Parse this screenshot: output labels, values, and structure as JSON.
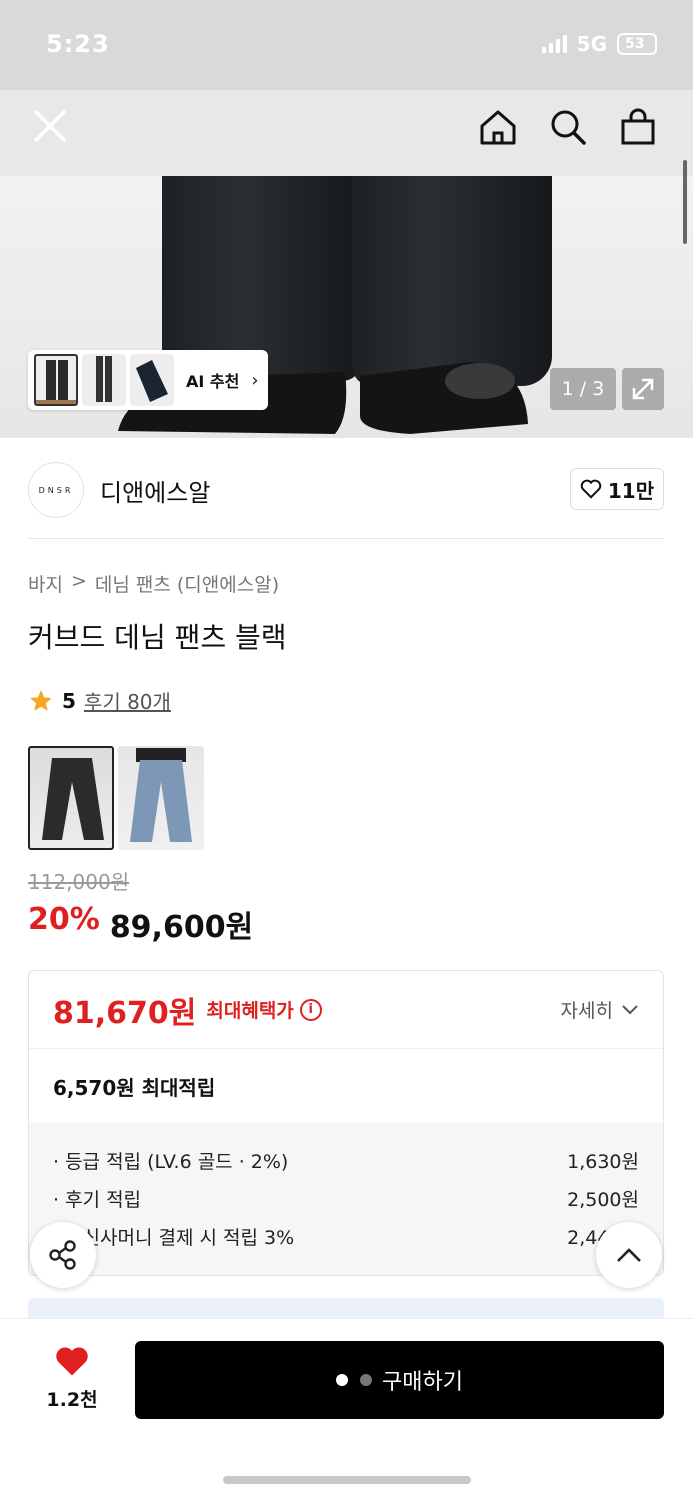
{
  "status_bar": {
    "time": "5:23",
    "network": "5G",
    "battery": "53"
  },
  "nav": {
    "close_icon": "close-icon",
    "home_icon": "home-icon",
    "search_icon": "search-icon",
    "cart_icon": "shopping-bag-icon"
  },
  "hero": {
    "ai_label": "AI 추천",
    "page_indicator": "1 / 3"
  },
  "brand": {
    "logo_text": "DNSR",
    "name": "디앤에스알",
    "likes": "11만"
  },
  "breadcrumb": {
    "category": "바지",
    "separator": ">",
    "sub": "데님 팬츠 (디앤에스알)"
  },
  "product": {
    "title": "커브드 데님 팬츠 블랙",
    "rating": "5",
    "reviews": "후기 80개",
    "original_price": "112,000원",
    "discount": "20%",
    "price": "89,600원"
  },
  "benefit": {
    "max_price": "81,670원",
    "max_label": "최대혜택가",
    "details": "자세히",
    "max_points": "6,570원 최대적립",
    "rows": [
      {
        "label": "· 등급 적립 (LV.6 골드 · 2%)",
        "value": "1,630원"
      },
      {
        "label": "· 후기 적립",
        "value": "2,500원"
      },
      {
        "label": "· 무신사머니 결제 시 적립 3%",
        "value": "2,440원"
      }
    ]
  },
  "bottom": {
    "wish_count": "1.2천",
    "buy_label": "구매하기"
  },
  "colors": {
    "accent_red": "#e02020",
    "buy_button": "#000000",
    "star": "#f5a623"
  }
}
